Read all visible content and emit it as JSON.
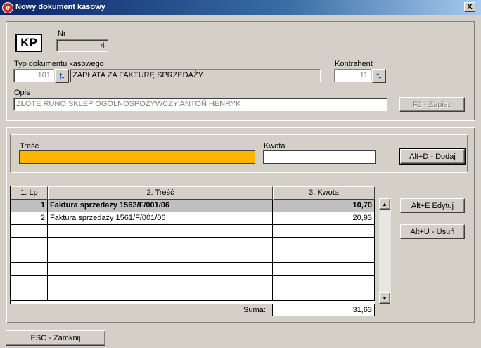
{
  "window": {
    "title": "Nowy dokument kasowy",
    "close_glyph": "X",
    "app_icon_glyph": "e"
  },
  "header": {
    "doc_kind": "KP",
    "nr_label": "Nr",
    "nr_value": "4",
    "doc_type_label": "Typ dokumentu kasowego",
    "doc_type_code": "101",
    "doc_type_name": "ZAPŁATA ZA FAKTURĘ SPRZEDAŻY",
    "contractor_label": "Kontrahent",
    "contractor_code": "11",
    "description_label": "Opis",
    "description_value": "ZŁOTE RUNO SKLEP OGÓLNOSPOŻYWCZY ANTOŃ HENRYK",
    "save_button": "F2 - Zapisz"
  },
  "entry": {
    "content_label": "Treść",
    "content_value": "",
    "amount_label": "Kwota",
    "amount_value": "",
    "add_button": "Alt+D - Dodaj"
  },
  "grid": {
    "columns": [
      "1. Lp",
      "2. Treść",
      "3. Kwota"
    ],
    "rows": [
      {
        "lp": "1",
        "tresc": "Faktura sprzedaży 1562/F/001/06",
        "kwota": "10,70"
      },
      {
        "lp": "2",
        "tresc": "Faktura sprzedaży 1561/F/001/06",
        "kwota": "20,93"
      },
      {
        "lp": "",
        "tresc": "",
        "kwota": ""
      },
      {
        "lp": "",
        "tresc": "",
        "kwota": ""
      },
      {
        "lp": "",
        "tresc": "",
        "kwota": ""
      },
      {
        "lp": "",
        "tresc": "",
        "kwota": ""
      },
      {
        "lp": "",
        "tresc": "",
        "kwota": ""
      },
      {
        "lp": "",
        "tresc": "",
        "kwota": ""
      }
    ],
    "sum_label": "Suma:",
    "sum_value": "31,63",
    "edit_button": "Alt+E Edytuj",
    "delete_button": "Alt+U - Usuń"
  },
  "footer": {
    "close_button": "ESC - Zamknij"
  },
  "colors": {
    "highlight_input": "#ffb400",
    "titlebar": "#0a246a"
  },
  "icons": {
    "lookup": "lookup-icon",
    "scroll_up": "scroll-up-icon",
    "scroll_down": "scroll-down-icon"
  }
}
